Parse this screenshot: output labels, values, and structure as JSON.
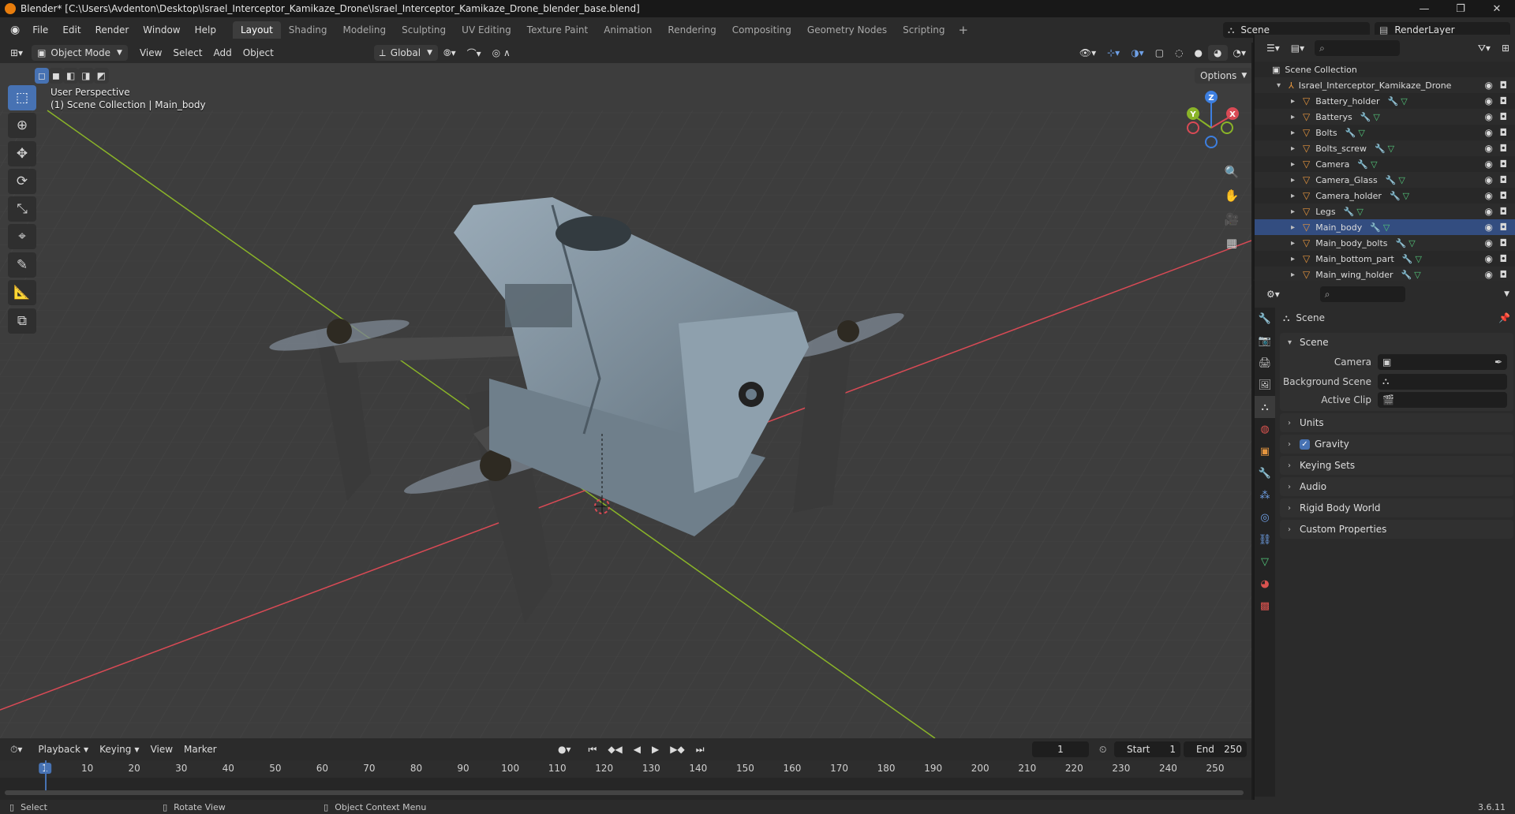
{
  "window": {
    "title": "Blender* [C:\\Users\\Avdenton\\Desktop\\Israel_Interceptor_Kamikaze_Drone\\Israel_Interceptor_Kamikaze_Drone_blender_base.blend]",
    "minimize": "—",
    "maximize": "❐",
    "close": "✕"
  },
  "menu": [
    "File",
    "Edit",
    "Render",
    "Window",
    "Help"
  ],
  "workspaces": [
    "Layout",
    "Shading",
    "Modeling",
    "Sculpting",
    "UV Editing",
    "Texture Paint",
    "Animation",
    "Rendering",
    "Compositing",
    "Geometry Nodes",
    "Scripting"
  ],
  "active_workspace": "Layout",
  "add_workspace": "+",
  "scene": {
    "label": "Scene",
    "render_layer": "RenderLayer"
  },
  "viewport_header": {
    "mode": "Object Mode",
    "menus": [
      "View",
      "Select",
      "Add",
      "Object"
    ],
    "transform_orientation": "Global",
    "options": "Options"
  },
  "viewport": {
    "perspective": "User Perspective",
    "context": "(1) Scene Collection | Main_body",
    "gizmo_axes": {
      "x": "X",
      "y": "Y",
      "z": "Z"
    },
    "colors": {
      "x_axis": "#d94a55",
      "y_axis": "#8ab428",
      "z_axis": "#3d7fe0",
      "grid": "#474747",
      "background": "#3d3d3d",
      "body": "#7e8f9c"
    }
  },
  "outliner": {
    "root": "Scene Collection",
    "collection": "Israel_Interceptor_Kamikaze_Drone",
    "objects": [
      "Battery_holder",
      "Batterys",
      "Bolts",
      "Bolts_screw",
      "Camera",
      "Camera_Glass",
      "Camera_holder",
      "Legs",
      "Main_body",
      "Main_body_bolts",
      "Main_bottom_part",
      "Main_wing_holder"
    ],
    "selected": "Main_body"
  },
  "properties": {
    "context": "Scene",
    "panel_title": "Scene",
    "fields": [
      {
        "label": "Camera"
      },
      {
        "label": "Background Scene"
      },
      {
        "label": "Active Clip"
      }
    ],
    "panels": [
      "Units",
      "Gravity",
      "Keying Sets",
      "Audio",
      "Rigid Body World",
      "Custom Properties"
    ]
  },
  "timeline": {
    "menus": [
      "Playback",
      "Keying",
      "View",
      "Marker"
    ],
    "current_frame": "1",
    "start_label": "Start",
    "start": "1",
    "end_label": "End",
    "end": "250",
    "ticks": [
      "1",
      "10",
      "20",
      "30",
      "40",
      "50",
      "60",
      "70",
      "80",
      "90",
      "100",
      "110",
      "120",
      "130",
      "140",
      "150",
      "160",
      "170",
      "180",
      "190",
      "200",
      "210",
      "220",
      "230",
      "240",
      "250"
    ]
  },
  "statusbar": {
    "items": [
      "Select",
      "Rotate View",
      "Object Context Menu"
    ],
    "version": "3.6.11"
  }
}
